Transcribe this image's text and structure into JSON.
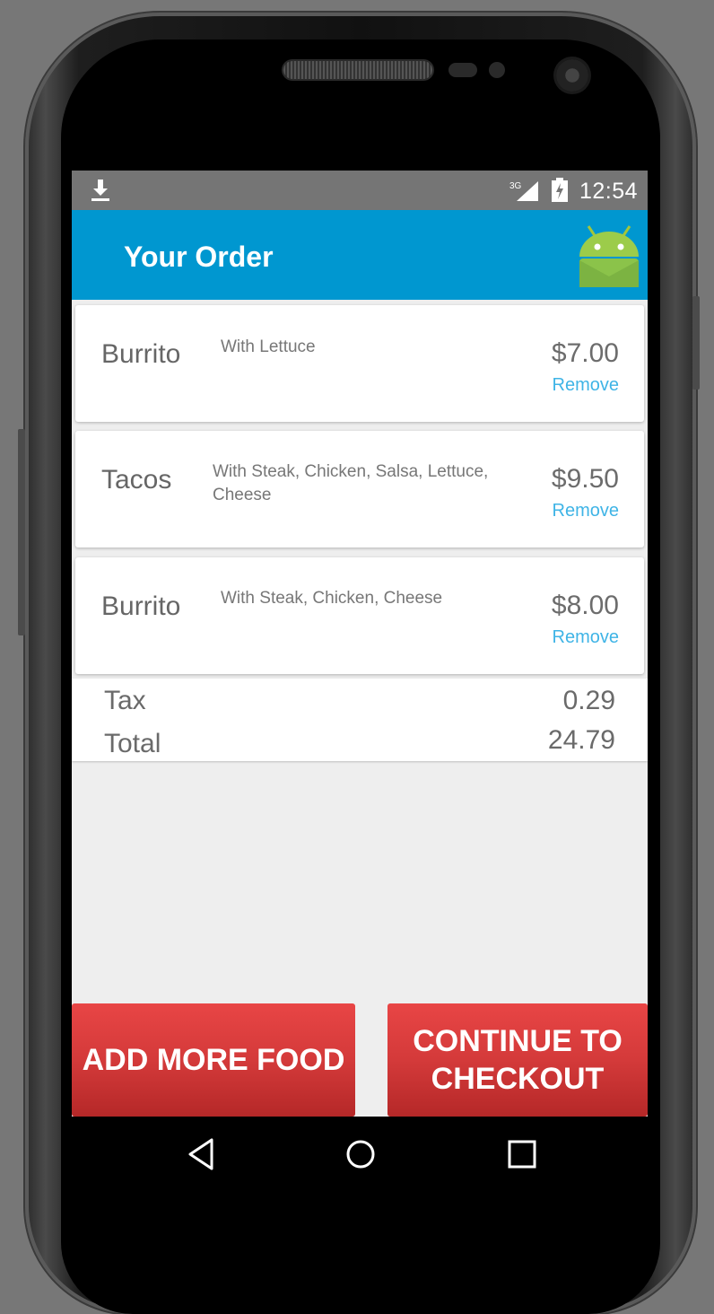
{
  "status_bar": {
    "time": "12:54",
    "network": "3G"
  },
  "app_bar": {
    "title": "Your Order"
  },
  "order_items": [
    {
      "name": "Burrito",
      "description": "With Lettuce",
      "price": "$7.00",
      "remove_label": "Remove"
    },
    {
      "name": "Tacos",
      "description": "With Steak, Chicken, Salsa, Lettuce, Cheese",
      "price": "$9.50",
      "remove_label": "Remove"
    },
    {
      "name": "Burrito",
      "description": "With Steak, Chicken, Cheese",
      "price": "$8.00",
      "remove_label": "Remove"
    }
  ],
  "summary": {
    "tax_label": "Tax",
    "tax_value": "0.29",
    "total_label": "Total",
    "total_value": "24.79"
  },
  "buttons": {
    "add_more": "ADD MORE FOOD",
    "checkout": "CONTINUE TO\nCHECKOUT"
  },
  "colors": {
    "app_bar": "#0097d0",
    "status_bar": "#757575",
    "remove_link": "#3fb4e6",
    "button": "#d43a3a"
  },
  "icons": {
    "status": [
      "download-icon",
      "signal-icon",
      "battery-icon"
    ],
    "app": "android-logo-icon",
    "nav": [
      "back-icon",
      "home-icon",
      "recents-icon"
    ]
  }
}
